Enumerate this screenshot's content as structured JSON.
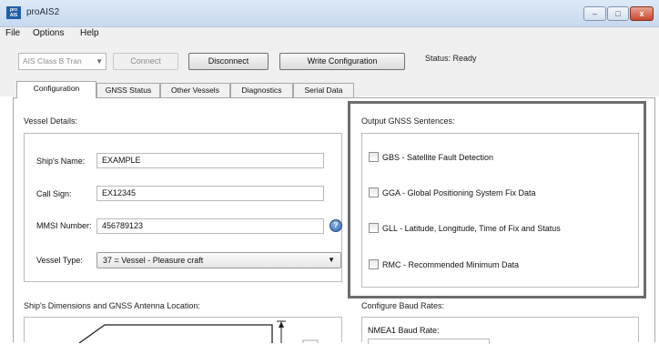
{
  "window": {
    "title": "proAIS2",
    "app_icon_text": "pro AIS",
    "controls": {
      "minimize": "–",
      "maximize": "□",
      "close": "x"
    }
  },
  "menu": {
    "items": [
      "File",
      "Options",
      "Help"
    ]
  },
  "toolbar": {
    "device_select": "AIS Class B Tran",
    "connect": "Connect",
    "disconnect": "Disconnect",
    "write_configuration": "Write Configuration",
    "status": "Status: Ready"
  },
  "tabs": [
    "Configuration",
    "GNSS Status",
    "Other Vessels",
    "Diagnostics",
    "Serial Data"
  ],
  "vessel_details": {
    "heading": "Vessel Details:",
    "ships_name_label": "Ship's Name:",
    "ships_name": "EXAMPLE",
    "call_sign_label": "Call Sign:",
    "call_sign": "EX12345",
    "mmsi_label": "MMSI Number:",
    "mmsi": "456789123",
    "help_icon": "?",
    "vessel_type_label": "Vessel Type:",
    "vessel_type": "37 = Vessel - Pleasure craft"
  },
  "output_gnss": {
    "heading": "Output GNSS Sentences:",
    "sentences": [
      {
        "label": "GBS - Satellite Fault Detection",
        "checked": false
      },
      {
        "label": "GGA - Global Positioning System Fix Data",
        "checked": false
      },
      {
        "label": "GLL - Latitude, Longitude, Time of Fix and Status",
        "checked": false
      },
      {
        "label": "RMC - Recommended Minimum Data",
        "checked": false
      }
    ]
  },
  "dimensions": {
    "heading": "Ship's Dimensions and GNSS Antenna Location:"
  },
  "baud": {
    "heading": "Configure Baud Rates:",
    "nmea1_label": "NMEA1 Baud Rate:"
  },
  "colors": {
    "highlight_border": "#6d6d6d",
    "title_bar": "#d3e2f3",
    "panel": "#f0f0f0"
  }
}
